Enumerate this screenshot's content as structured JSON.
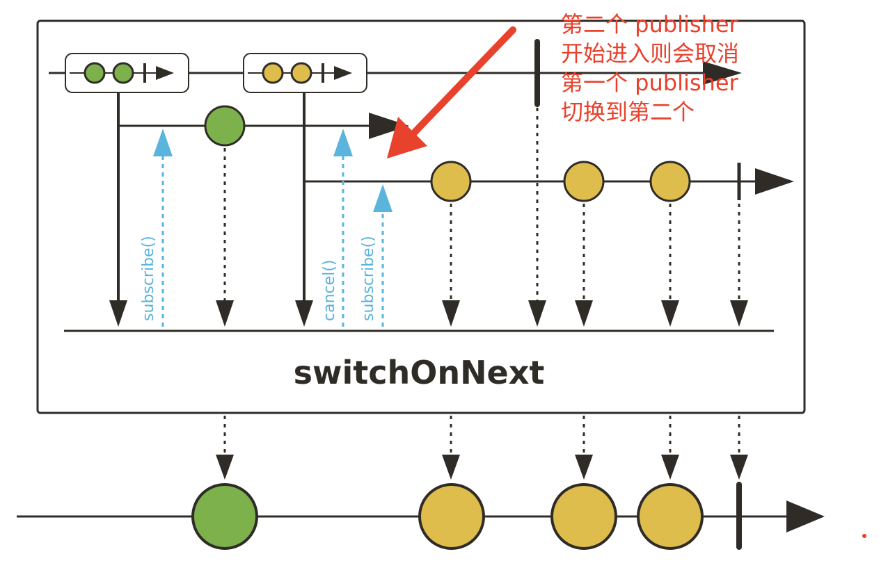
{
  "operator_name": "switchOnNext",
  "method_labels": {
    "subscribe_first": "subscribe()",
    "cancel": "cancel()",
    "subscribe_second": "subscribe()"
  },
  "annotation_lines": [
    "第二个 publisher",
    "开始进入则会取消",
    "第一个 publisher",
    "切换到第二个"
  ],
  "colors": {
    "line": "#2f2c28",
    "first_publisher": "#7cb14b",
    "second_publisher": "#dfbd4c",
    "method_arrow": "#5ab4dc",
    "annotation": "#e8412c"
  }
}
